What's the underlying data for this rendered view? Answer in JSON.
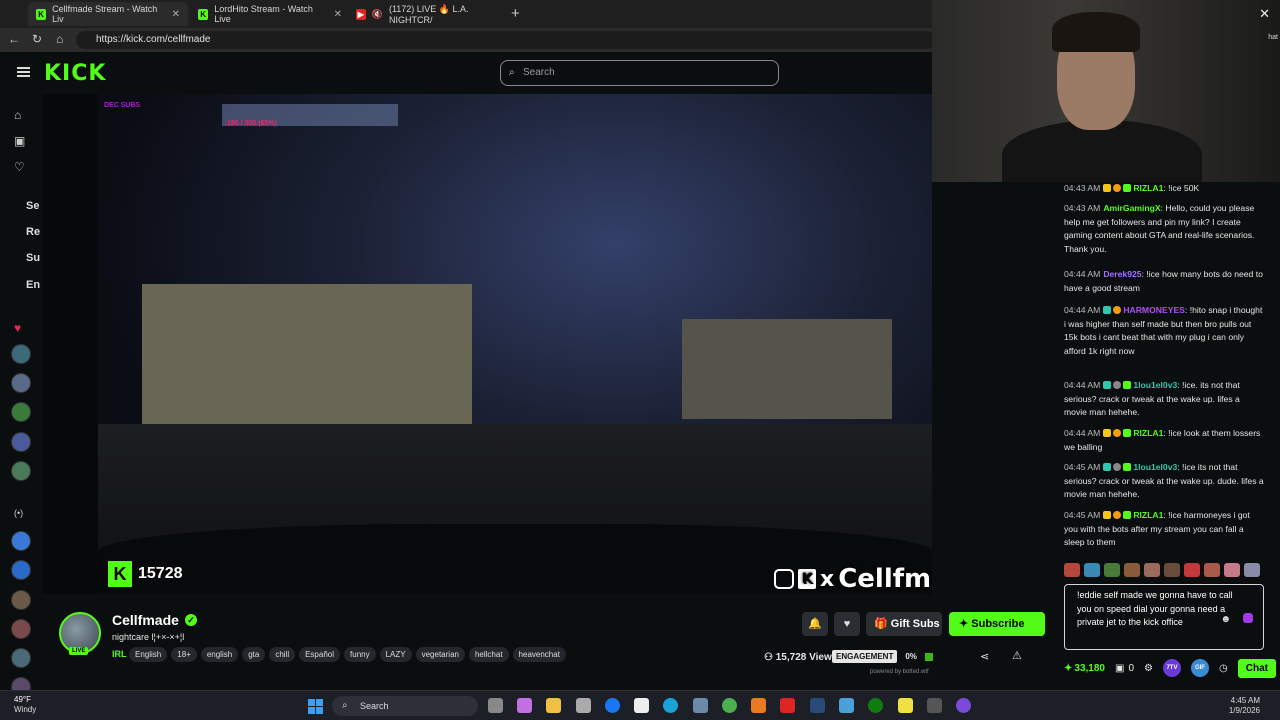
{
  "browser": {
    "tabs": [
      {
        "title": "Cellfmade Stream - Watch Liv",
        "active": true,
        "favicon": "kick-icon"
      },
      {
        "title": "LordHito Stream - Watch Live",
        "active": false,
        "favicon": "kick-icon"
      },
      {
        "title": "(1172) LIVE 🔥 L.A. NIGHTCR/",
        "active": false,
        "favicon": "youtube-icon"
      }
    ],
    "url": "https://kick.com/cellfmade"
  },
  "header": {
    "logo": "KICK",
    "search_placeholder": "Search"
  },
  "sidebar": {
    "sections": [
      "Se",
      "Re",
      "Su",
      "En"
    ]
  },
  "video": {
    "overlay_top_left": "DEC SUBS",
    "overlay_goal": "196 / 300 (65%)",
    "overlay_viewers": "15728",
    "overlay_brand": "Cellfmade"
  },
  "webcam": {
    "side_fragment": "hat"
  },
  "chat": {
    "messages": [
      {
        "time": "04:43 AM",
        "user": "RIZLA1",
        "color": "#53fc18",
        "text": "!ice 50K"
      },
      {
        "time": "04:43 AM",
        "user": "AmirGamingX",
        "color": "#53fc18",
        "text": "Hello, could you please help me get followers and pin my link? I create gaming content about GTA and real-life scenarios. Thank you."
      },
      {
        "time": "04:44 AM",
        "user": "Derek925",
        "color": "#a66cff",
        "text": "!ice how many bots do need to have a good stream"
      },
      {
        "time": "04:44 AM",
        "user": "HARMONEYES",
        "color": "#b04cff",
        "text": "!hito snap i thought i was higher than self made but then bro pulls out 15k bots i cant beat that with my plug i can only afford 1k right now"
      },
      {
        "time": "04:44 AM",
        "user": "1lou1el0v3",
        "color": "#2ec7b0",
        "text": "!ice. its not that serious? crack or tweak at the wake up. lifes a movie man hehehe."
      },
      {
        "time": "04:44 AM",
        "user": "RIZLA1",
        "color": "#53fc18",
        "text": "!ice look at them lossers we balling"
      },
      {
        "time": "04:45 AM",
        "user": "1lou1el0v3",
        "color": "#2ec7b0",
        "text": "!ice its not that serious? crack or tweak at the wake up. dude. lifes a movie man hehehe."
      },
      {
        "time": "04:45 AM",
        "user": "RIZLA1",
        "color": "#53fc18",
        "text": "!ice harmoneyes i got you with the bots after my stream you can fall a sleep to them"
      }
    ],
    "input_value": "!eddie self made we gonna have to call you on speed dial your gonna need a private jet to the kick office",
    "points": "33,180",
    "count": "0",
    "chat_button": "Chat",
    "badges": [
      "7TV",
      "GIF"
    ]
  },
  "channel": {
    "name": "Cellfmade",
    "live_badge": "LIVE",
    "subtitle": "nightcare l¦+×-×+¦l",
    "category": "IRL",
    "tags": [
      "English",
      "18+",
      "english",
      "gta",
      "chill",
      "Español",
      "funny",
      "LAZY",
      "vegetarian",
      "hellchat",
      "heavenchat"
    ],
    "gift_label": "Gift Subs",
    "subscribe_label": "Subscribe",
    "viewers": "15,728 Viewers",
    "engagement_label": "ENGAGEMENT",
    "engagement_value": "0%",
    "powered_by": "powered by botted.wtf"
  },
  "taskbar": {
    "temperature": "49°F",
    "condition": "Windy",
    "search": "Search",
    "time": "4:45 AM",
    "date": "1/9/2026"
  }
}
